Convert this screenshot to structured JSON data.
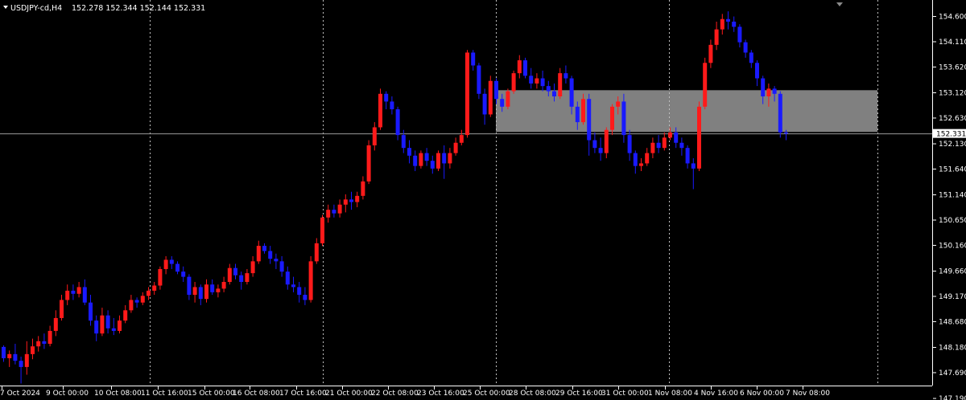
{
  "header": {
    "symbol": "USDJPY-cd,H4",
    "ohlc": "152.278 152.344 152.144 152.331"
  },
  "colors": {
    "background": "#000000",
    "bull": "#ff1a1a",
    "bear": "#1a1aff",
    "grid": "#bfbfbf",
    "zone": "#808080",
    "text": "#ffffff"
  },
  "chart_data": {
    "type": "candlestick",
    "symbol": "USDJPY-cd",
    "timeframe": "H4",
    "ylim": [
      147.44,
      154.92
    ],
    "y_ticks": [
      "154.600",
      "154.110",
      "153.620",
      "153.120",
      "152.630",
      "152.130",
      "151.640",
      "151.140",
      "150.650",
      "150.160",
      "149.660",
      "149.170",
      "148.680",
      "148.180",
      "147.690",
      "147.190"
    ],
    "x_ticks": [
      "7 Oct 2024",
      "9 Oct 00:00",
      "10 Oct 08:00",
      "11 Oct 16:00",
      "15 Oct 00:00",
      "16 Oct 08:00",
      "17 Oct 16:00",
      "21 Oct 00:00",
      "22 Oct 08:00",
      "23 Oct 16:00",
      "25 Oct 00:00",
      "28 Oct 08:00",
      "29 Oct 16:00",
      "31 Oct 00:00",
      "1 Nov 08:00",
      "4 Nov 16:00",
      "6 Nov 00:00",
      "7 Nov 08:00"
    ],
    "current_price": "152.331",
    "current_price_value": 152.331,
    "zone": {
      "low": 152.36,
      "high": 153.17
    },
    "candles": [
      [
        148.19,
        148.22,
        147.9,
        147.97
      ],
      [
        147.97,
        148.12,
        147.8,
        148.05
      ],
      [
        148.05,
        148.25,
        147.85,
        147.92
      ],
      [
        147.92,
        148.0,
        147.48,
        147.8
      ],
      [
        147.8,
        148.3,
        147.65,
        148.05
      ],
      [
        148.05,
        148.35,
        147.95,
        148.2
      ],
      [
        148.2,
        148.4,
        148.1,
        148.3
      ],
      [
        148.3,
        148.45,
        148.15,
        148.25
      ],
      [
        148.25,
        148.6,
        148.2,
        148.5
      ],
      [
        148.5,
        148.9,
        148.4,
        148.75
      ],
      [
        148.75,
        149.2,
        148.7,
        149.1
      ],
      [
        149.1,
        149.4,
        149.0,
        149.28
      ],
      [
        149.28,
        149.4,
        149.1,
        149.22
      ],
      [
        149.22,
        149.45,
        149.15,
        149.35
      ],
      [
        149.35,
        149.5,
        149.0,
        149.05
      ],
      [
        149.05,
        149.2,
        148.6,
        148.7
      ],
      [
        148.7,
        148.8,
        148.3,
        148.45
      ],
      [
        148.45,
        148.95,
        148.4,
        148.8
      ],
      [
        148.8,
        148.9,
        148.45,
        148.55
      ],
      [
        148.55,
        148.75,
        148.42,
        148.5
      ],
      [
        148.5,
        148.8,
        148.45,
        148.7
      ],
      [
        148.7,
        149.0,
        148.65,
        148.9
      ],
      [
        148.9,
        149.2,
        148.85,
        149.1
      ],
      [
        149.1,
        149.15,
        148.95,
        149.05
      ],
      [
        149.05,
        149.25,
        149.0,
        149.18
      ],
      [
        149.18,
        149.35,
        149.1,
        149.28
      ],
      [
        149.28,
        149.45,
        149.2,
        149.38
      ],
      [
        149.38,
        149.75,
        149.3,
        149.7
      ],
      [
        149.7,
        149.95,
        149.6,
        149.88
      ],
      [
        149.88,
        149.95,
        149.7,
        149.8
      ],
      [
        149.8,
        149.85,
        149.6,
        149.65
      ],
      [
        149.65,
        149.75,
        149.45,
        149.55
      ],
      [
        149.55,
        149.6,
        149.1,
        149.2
      ],
      [
        149.2,
        149.45,
        149.05,
        149.35
      ],
      [
        149.35,
        149.4,
        149.0,
        149.12
      ],
      [
        149.12,
        149.5,
        149.05,
        149.4
      ],
      [
        149.4,
        149.5,
        149.2,
        149.25
      ],
      [
        149.25,
        149.4,
        149.15,
        149.32
      ],
      [
        149.32,
        149.55,
        149.25,
        149.45
      ],
      [
        149.45,
        149.8,
        149.4,
        149.72
      ],
      [
        149.72,
        149.8,
        149.5,
        149.58
      ],
      [
        149.58,
        149.65,
        149.3,
        149.45
      ],
      [
        149.45,
        149.7,
        149.4,
        149.62
      ],
      [
        149.62,
        149.95,
        149.55,
        149.85
      ],
      [
        149.85,
        150.25,
        149.8,
        150.15
      ],
      [
        150.15,
        150.2,
        150.0,
        150.05
      ],
      [
        150.05,
        150.15,
        149.8,
        149.9
      ],
      [
        149.9,
        150.0,
        149.7,
        149.85
      ],
      [
        149.85,
        149.95,
        149.55,
        149.65
      ],
      [
        149.65,
        149.75,
        149.3,
        149.4
      ],
      [
        149.4,
        149.55,
        149.25,
        149.35
      ],
      [
        149.35,
        149.45,
        149.05,
        149.2
      ],
      [
        149.2,
        149.35,
        149.0,
        149.1
      ],
      [
        149.1,
        149.95,
        149.05,
        149.85
      ],
      [
        149.85,
        150.3,
        149.8,
        150.2
      ],
      [
        150.2,
        150.75,
        150.15,
        150.7
      ],
      [
        150.7,
        150.95,
        150.6,
        150.85
      ],
      [
        150.85,
        150.95,
        150.7,
        150.78
      ],
      [
        150.78,
        151.05,
        150.7,
        150.95
      ],
      [
        150.95,
        151.15,
        150.8,
        151.05
      ],
      [
        151.05,
        151.2,
        150.85,
        151.0
      ],
      [
        151.0,
        151.2,
        150.9,
        151.12
      ],
      [
        151.12,
        151.5,
        151.05,
        151.4
      ],
      [
        151.4,
        152.2,
        151.35,
        152.1
      ],
      [
        152.1,
        152.55,
        152.0,
        152.45
      ],
      [
        152.45,
        153.2,
        152.4,
        153.1
      ],
      [
        153.1,
        153.15,
        152.8,
        152.95
      ],
      [
        152.95,
        153.05,
        152.7,
        152.8
      ],
      [
        152.8,
        152.85,
        152.2,
        152.3
      ],
      [
        152.3,
        152.4,
        151.95,
        152.05
      ],
      [
        152.05,
        152.2,
        151.75,
        151.9
      ],
      [
        151.9,
        152.0,
        151.6,
        151.7
      ],
      [
        151.7,
        152.0,
        151.65,
        151.95
      ],
      [
        151.95,
        152.05,
        151.7,
        151.8
      ],
      [
        151.8,
        151.9,
        151.55,
        151.65
      ],
      [
        151.65,
        152.0,
        151.6,
        151.95
      ],
      [
        151.95,
        152.1,
        151.45,
        151.75
      ],
      [
        151.75,
        152.05,
        151.65,
        151.95
      ],
      [
        151.95,
        152.25,
        151.9,
        152.15
      ],
      [
        152.15,
        152.4,
        152.1,
        152.3
      ],
      [
        152.3,
        153.95,
        152.25,
        153.9
      ],
      [
        153.9,
        153.95,
        153.55,
        153.65
      ],
      [
        153.65,
        153.7,
        153.0,
        153.1
      ],
      [
        153.1,
        153.2,
        152.5,
        152.7
      ],
      [
        152.7,
        153.45,
        152.65,
        153.35
      ],
      [
        153.35,
        153.4,
        152.9,
        153.0
      ],
      [
        153.0,
        153.1,
        152.75,
        152.85
      ],
      [
        152.85,
        153.2,
        152.8,
        153.15
      ],
      [
        153.15,
        153.55,
        153.1,
        153.5
      ],
      [
        153.5,
        153.85,
        153.4,
        153.75
      ],
      [
        153.75,
        153.8,
        153.4,
        153.45
      ],
      [
        153.45,
        153.6,
        153.2,
        153.3
      ],
      [
        153.3,
        153.5,
        153.2,
        153.4
      ],
      [
        153.4,
        153.55,
        153.15,
        153.25
      ],
      [
        153.25,
        153.35,
        153.05,
        153.15
      ],
      [
        153.15,
        153.3,
        152.95,
        153.05
      ],
      [
        153.05,
        153.6,
        153.0,
        153.5
      ],
      [
        153.5,
        153.65,
        153.3,
        153.4
      ],
      [
        153.4,
        153.45,
        152.7,
        152.85
      ],
      [
        152.85,
        152.95,
        152.4,
        152.55
      ],
      [
        152.55,
        153.1,
        152.5,
        153.0
      ],
      [
        153.0,
        153.1,
        151.9,
        152.2
      ],
      [
        152.2,
        152.35,
        151.95,
        152.05
      ],
      [
        152.05,
        152.25,
        151.8,
        151.95
      ],
      [
        151.95,
        152.45,
        151.85,
        152.4
      ],
      [
        152.4,
        152.9,
        152.3,
        152.85
      ],
      [
        152.85,
        153.05,
        152.7,
        152.95
      ],
      [
        152.95,
        153.1,
        152.15,
        152.3
      ],
      [
        152.3,
        152.4,
        151.8,
        151.95
      ],
      [
        151.95,
        152.0,
        151.55,
        151.7
      ],
      [
        151.7,
        151.85,
        151.6,
        151.75
      ],
      [
        151.75,
        152.05,
        151.7,
        151.95
      ],
      [
        151.95,
        152.25,
        151.85,
        152.15
      ],
      [
        152.15,
        152.3,
        151.95,
        152.05
      ],
      [
        152.05,
        152.35,
        152.0,
        152.25
      ],
      [
        152.25,
        152.45,
        152.2,
        152.35
      ],
      [
        152.35,
        152.45,
        152.05,
        152.15
      ],
      [
        152.15,
        152.25,
        151.9,
        152.05
      ],
      [
        152.05,
        152.1,
        151.65,
        151.75
      ],
      [
        151.75,
        151.85,
        151.25,
        151.65
      ],
      [
        151.65,
        152.95,
        151.6,
        152.85
      ],
      [
        152.85,
        153.8,
        152.8,
        153.7
      ],
      [
        153.7,
        154.15,
        153.6,
        154.05
      ],
      [
        154.05,
        154.5,
        153.95,
        154.35
      ],
      [
        154.35,
        154.65,
        154.25,
        154.55
      ],
      [
        154.55,
        154.7,
        154.35,
        154.5
      ],
      [
        154.5,
        154.6,
        154.3,
        154.4
      ],
      [
        154.4,
        154.45,
        154.0,
        154.1
      ],
      [
        154.1,
        154.15,
        153.8,
        153.9
      ],
      [
        153.9,
        153.95,
        153.6,
        153.7
      ],
      [
        153.7,
        153.75,
        153.25,
        153.4
      ],
      [
        153.4,
        153.45,
        152.9,
        153.05
      ],
      [
        153.05,
        153.3,
        152.85,
        153.2
      ],
      [
        153.2,
        153.25,
        152.95,
        153.1
      ],
      [
        153.1,
        153.15,
        152.25,
        152.35
      ],
      [
        152.35,
        152.4,
        152.2,
        152.33
      ]
    ]
  }
}
